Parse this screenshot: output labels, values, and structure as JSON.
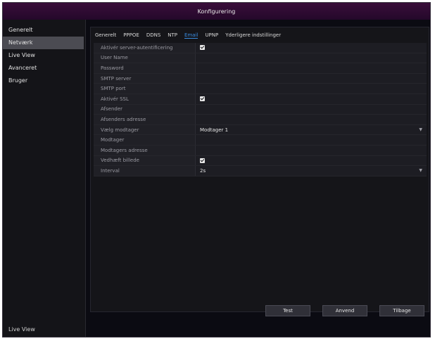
{
  "window": {
    "title": "Konfigurering"
  },
  "sidebar": {
    "items": [
      {
        "label": "Generelt"
      },
      {
        "label": "Netværk"
      },
      {
        "label": "Live View"
      },
      {
        "label": "Avanceret"
      },
      {
        "label": "Bruger"
      }
    ],
    "bottom_label": "Live View"
  },
  "tabs": [
    {
      "label": "Generelt"
    },
    {
      "label": "PPPOE"
    },
    {
      "label": "DDNS"
    },
    {
      "label": "NTP"
    },
    {
      "label": "Email"
    },
    {
      "label": "UPNP"
    },
    {
      "label": "Yderligere indstillinger"
    }
  ],
  "form": {
    "server_auth": {
      "label": "Aktivér server-autentificering",
      "checked": true
    },
    "user_name": {
      "label": "User Name",
      "value": ""
    },
    "password": {
      "label": "Password",
      "value": ""
    },
    "smtp_server": {
      "label": "SMTP server",
      "value": ""
    },
    "smtp_port": {
      "label": "SMTP port",
      "value": ""
    },
    "ssl": {
      "label": "Aktivér SSL",
      "checked": true
    },
    "sender": {
      "label": "Afsender",
      "value": ""
    },
    "sender_address": {
      "label": "Afsenders adresse",
      "value": ""
    },
    "select_receiver": {
      "label": "Vælg modtager",
      "value": "Modtager 1"
    },
    "receiver": {
      "label": "Modtager",
      "value": ""
    },
    "receiver_address": {
      "label": "Modtagers adresse",
      "value": ""
    },
    "attach_image": {
      "label": "Vedhæft billede",
      "checked": true
    },
    "interval": {
      "label": "Interval",
      "value": "2s"
    }
  },
  "buttons": {
    "test": "Test",
    "apply": "Anvend",
    "back": "Tilbage"
  },
  "colors": {
    "title_bar": "#3a0e3a",
    "active_tab": "#3a8ce0",
    "background": "#0b0b12"
  },
  "icons": {
    "dropdown": "chevron-down-icon",
    "checkbox": "checkbox-checked-icon"
  }
}
